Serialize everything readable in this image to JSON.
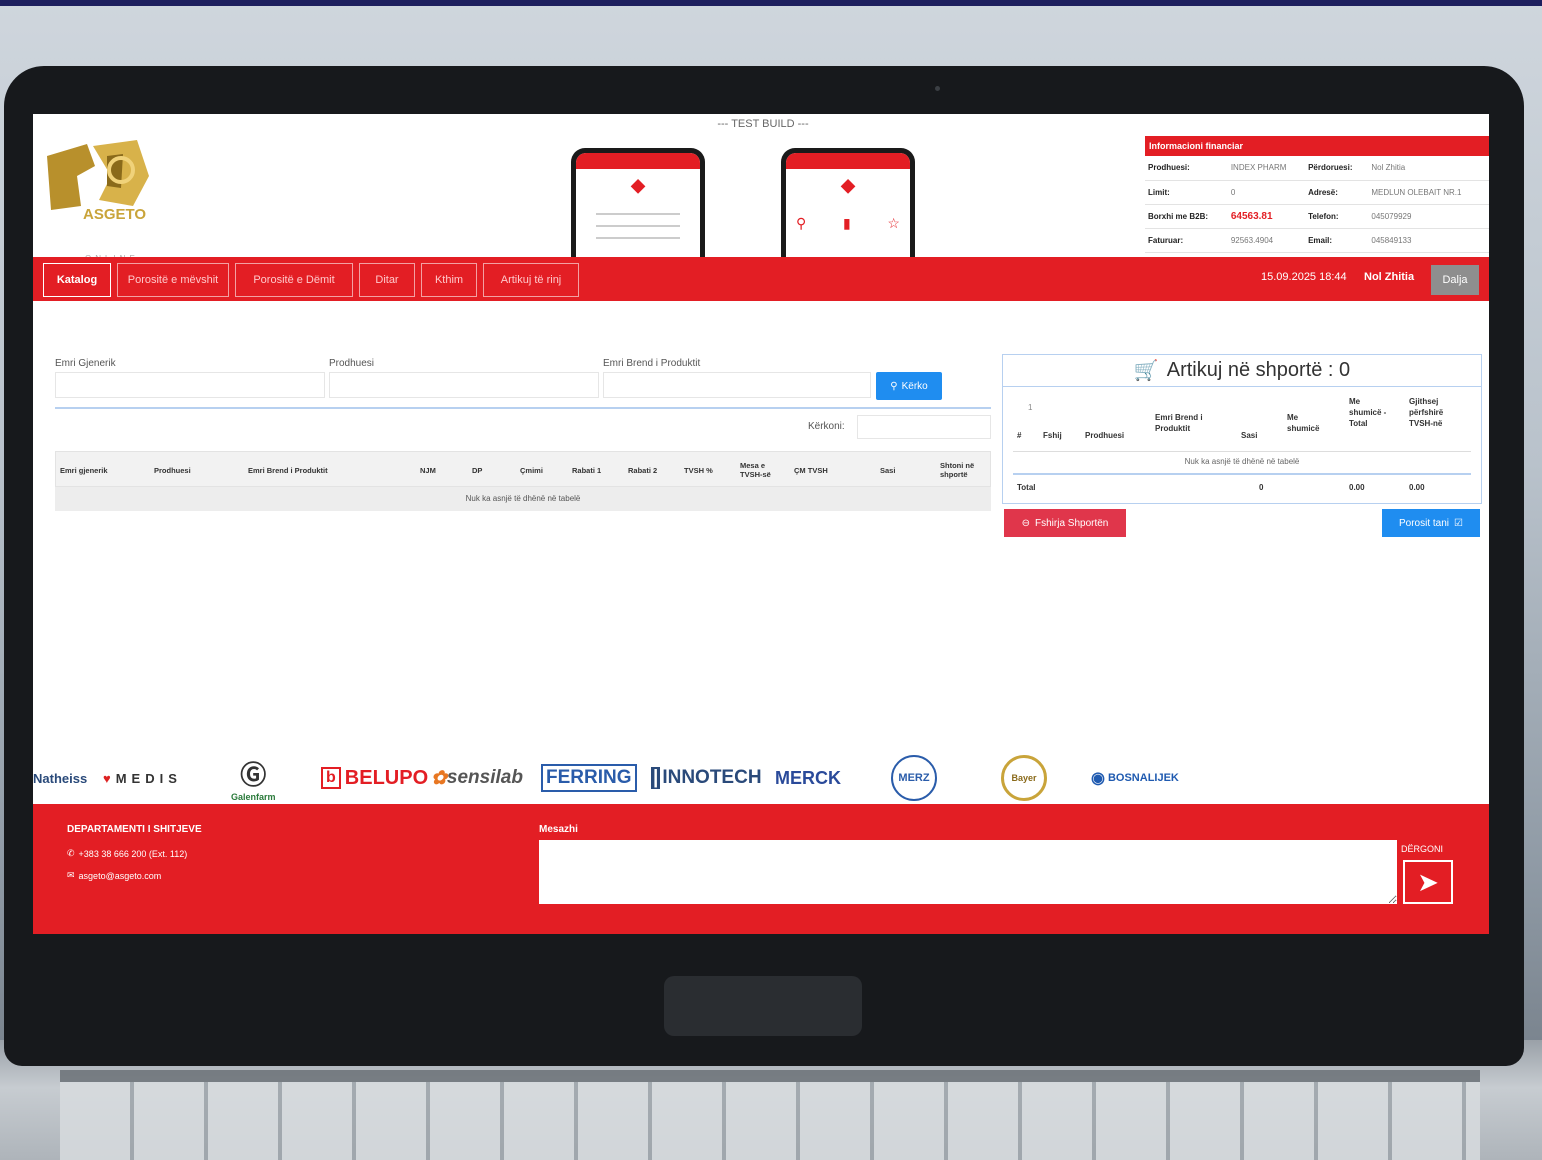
{
  "test_build": "--- TEST BUILD ---",
  "logo": {
    "text": "ASGETO",
    "sub": "ONLINE"
  },
  "financial": {
    "title": "Informacioni financiar",
    "rows": [
      {
        "k1": "Prodhuesi:",
        "v1": "INDEX PHARM",
        "k2": "Përdoruesi:",
        "v2": "Nol Zhitia"
      },
      {
        "k1": "Limit:",
        "v1": "0",
        "k2": "Adresë:",
        "v2": "MEDLUN OLEBAIT NR.1"
      },
      {
        "k1": "Borxhi me B2B:",
        "v1": "64563.81",
        "k2": "Telefon:",
        "v2": "045079929"
      },
      {
        "k1": "Faturuar:",
        "v1": "92563.4904",
        "k2": "Email:",
        "v2": "045849133"
      }
    ]
  },
  "nav": {
    "items": [
      "Katalog",
      "Porositë e mëvshit",
      "Porositë e Dëmit",
      "Ditar",
      "Kthim",
      "Artikuj të rinj"
    ],
    "active": "Katalog",
    "date": "15.09.2025 18:44",
    "user": "Nol Zhitia",
    "exit": "Dalja"
  },
  "search": {
    "generic_label": "Emri Gjenerik",
    "producer_label": "Prodhuesi",
    "brand_label": "Emri Brend i Produktit",
    "search_button": "Kërko",
    "filter_label": "Kërkoni:"
  },
  "grid": {
    "columns": [
      "Emri gjenerik",
      "Prodhuesi",
      "Emri Brend i Produktit",
      "NJM",
      "DP",
      "Çmimi",
      "Rabati 1",
      "Rabati 2",
      "TVSH %",
      "Mesa e TVSH-së",
      "ÇM TVSH",
      "Sasi",
      "Shtoni në shportë"
    ],
    "empty": "Nuk ka asnjë të dhënë në tabelë"
  },
  "cart": {
    "title": "Artikuj në shportë : 0",
    "row_index": "1",
    "columns": [
      "#",
      "Fshij",
      "Prodhuesi",
      "Emri Brend i Produktit",
      "Sasi",
      "Me shumicë",
      "Me shumicë - Total",
      "Gjithsej përfshirë TVSH-në"
    ],
    "empty": "Nuk ka asnjë të dhënë në tabelë",
    "total_label": "Total",
    "total_qty": "0",
    "total_amount": "0.00",
    "total_vat": "0.00",
    "empty_button": "Fshirja Shportën",
    "order_button": "Porosit tani"
  },
  "brands": [
    "Natheiss",
    "MEDIS",
    "Galenfarm",
    "BELUPO",
    "sensilab",
    "FERRING",
    "INNOTECH",
    "MERCK",
    "MERZ",
    "Bayer",
    "BOSNALIJEK"
  ],
  "footer": {
    "dept_title": "DEPARTAMENTI I SHITJEVE",
    "phone": "+383 38 666 200 (Ext. 112)",
    "email": "asgeto@asgeto.com",
    "message_label": "Mesazhi",
    "send_label": "DËRGONI"
  },
  "colors": {
    "brand_red": "#e31e24",
    "primary_blue": "#1f8df0",
    "gold": "#c9a43a"
  }
}
